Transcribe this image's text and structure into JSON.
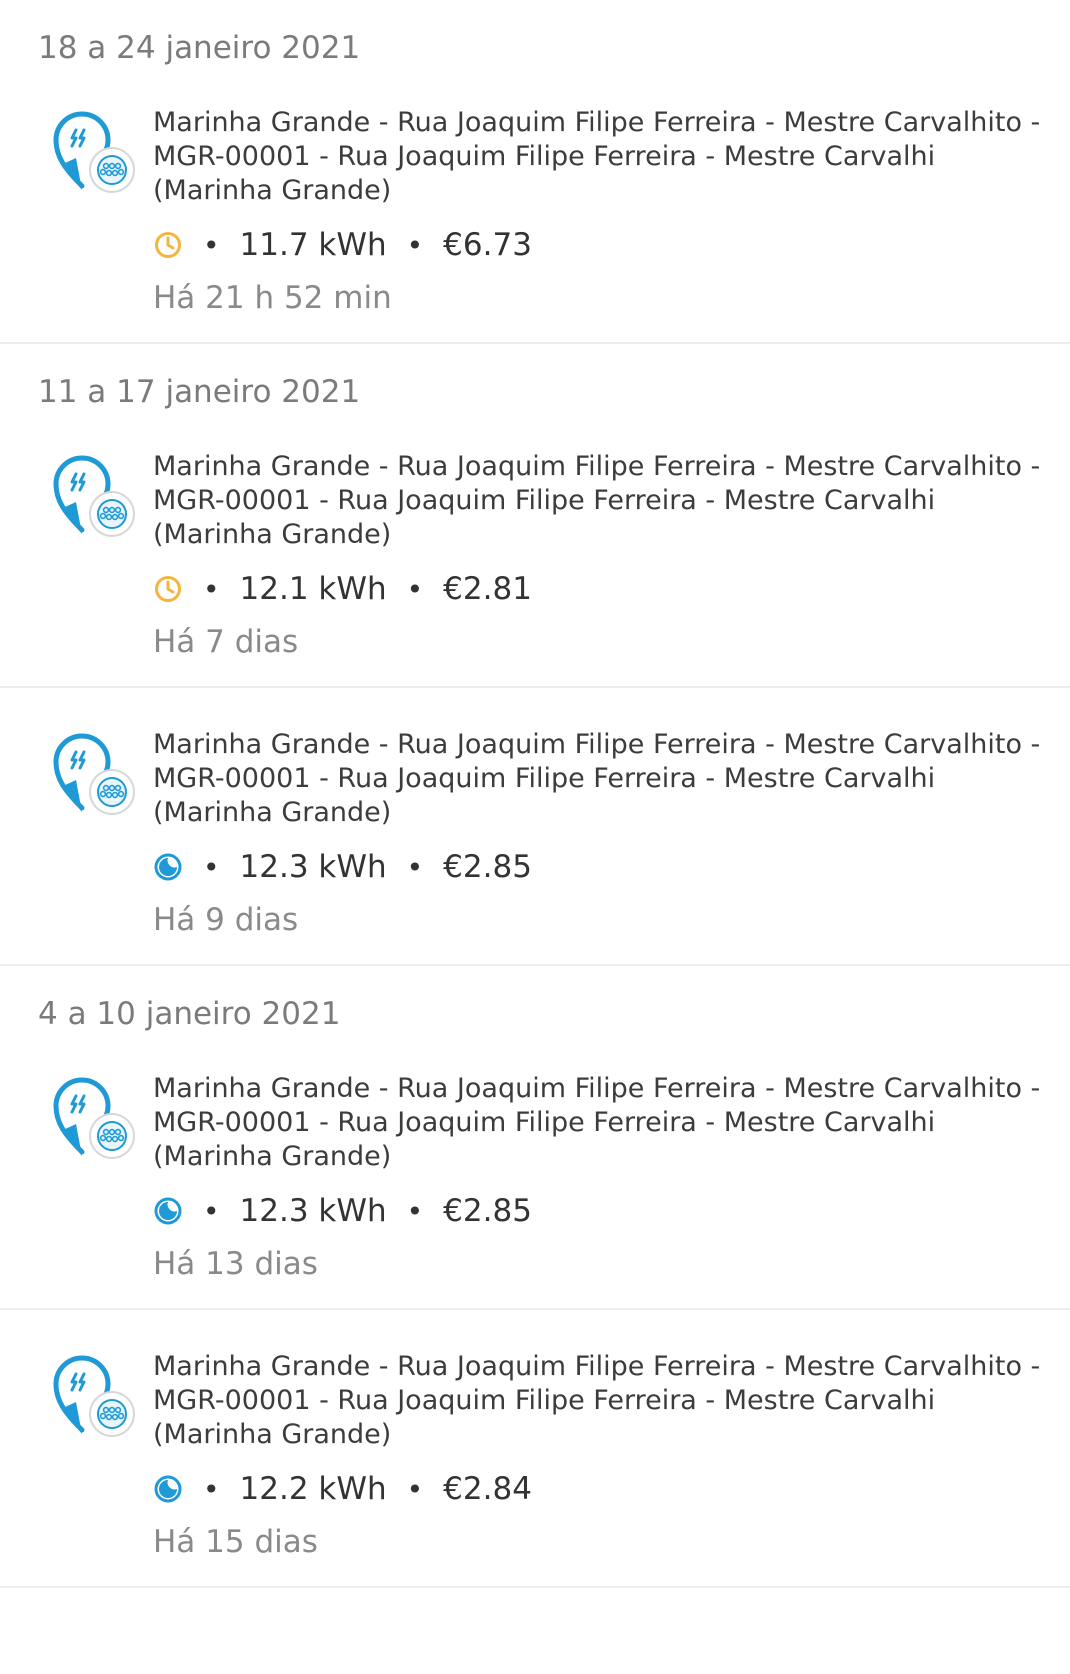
{
  "colors": {
    "accent_blue": "#1f9ad6",
    "clock_orange": "#f4b53f",
    "muted_text": "#8a8a8a"
  },
  "groups": [
    {
      "label": "18 a 24 janeiro 2021",
      "sessions": [
        {
          "location_line1": "Marinha Grande - Rua Joaquim Filipe Ferreira - Mestre Carvalhito -",
          "location_line2": "MGR-00001 - Rua Joaquim Filipe Ferreira - Mestre Carvalhi",
          "location_line3": "(Marinha Grande)",
          "status_icon": "clock-icon",
          "energy": "11.7 kWh",
          "price": "€6.73",
          "ago": "Há 21 h 52 min"
        }
      ]
    },
    {
      "label": "11 a 17 janeiro 2021",
      "sessions": [
        {
          "location_line1": "Marinha Grande - Rua Joaquim Filipe Ferreira - Mestre Carvalhito -",
          "location_line2": "MGR-00001 - Rua Joaquim Filipe Ferreira - Mestre Carvalhi",
          "location_line3": "(Marinha Grande)",
          "status_icon": "clock-icon",
          "energy": "12.1 kWh",
          "price": "€2.81",
          "ago": "Há 7 dias"
        },
        {
          "location_line1": "Marinha Grande - Rua Joaquim Filipe Ferreira - Mestre Carvalhito -",
          "location_line2": "MGR-00001 - Rua Joaquim Filipe Ferreira - Mestre Carvalhi",
          "location_line3": "(Marinha Grande)",
          "status_icon": "moon-icon",
          "energy": "12.3 kWh",
          "price": "€2.85",
          "ago": "Há 9 dias"
        }
      ]
    },
    {
      "label": "4 a 10 janeiro 2021",
      "sessions": [
        {
          "location_line1": "Marinha Grande - Rua Joaquim Filipe Ferreira - Mestre Carvalhito -",
          "location_line2": "MGR-00001 - Rua Joaquim Filipe Ferreira - Mestre Carvalhi",
          "location_line3": "(Marinha Grande)",
          "status_icon": "moon-icon",
          "energy": "12.3 kWh",
          "price": "€2.85",
          "ago": "Há 13 dias"
        },
        {
          "location_line1": "Marinha Grande - Rua Joaquim Filipe Ferreira - Mestre Carvalhito -",
          "location_line2": "MGR-00001 - Rua Joaquim Filipe Ferreira - Mestre Carvalhi",
          "location_line3": "(Marinha Grande)",
          "status_icon": "moon-icon",
          "energy": "12.2 kWh",
          "price": "€2.84",
          "ago": "Há 15 dias"
        }
      ]
    }
  ]
}
